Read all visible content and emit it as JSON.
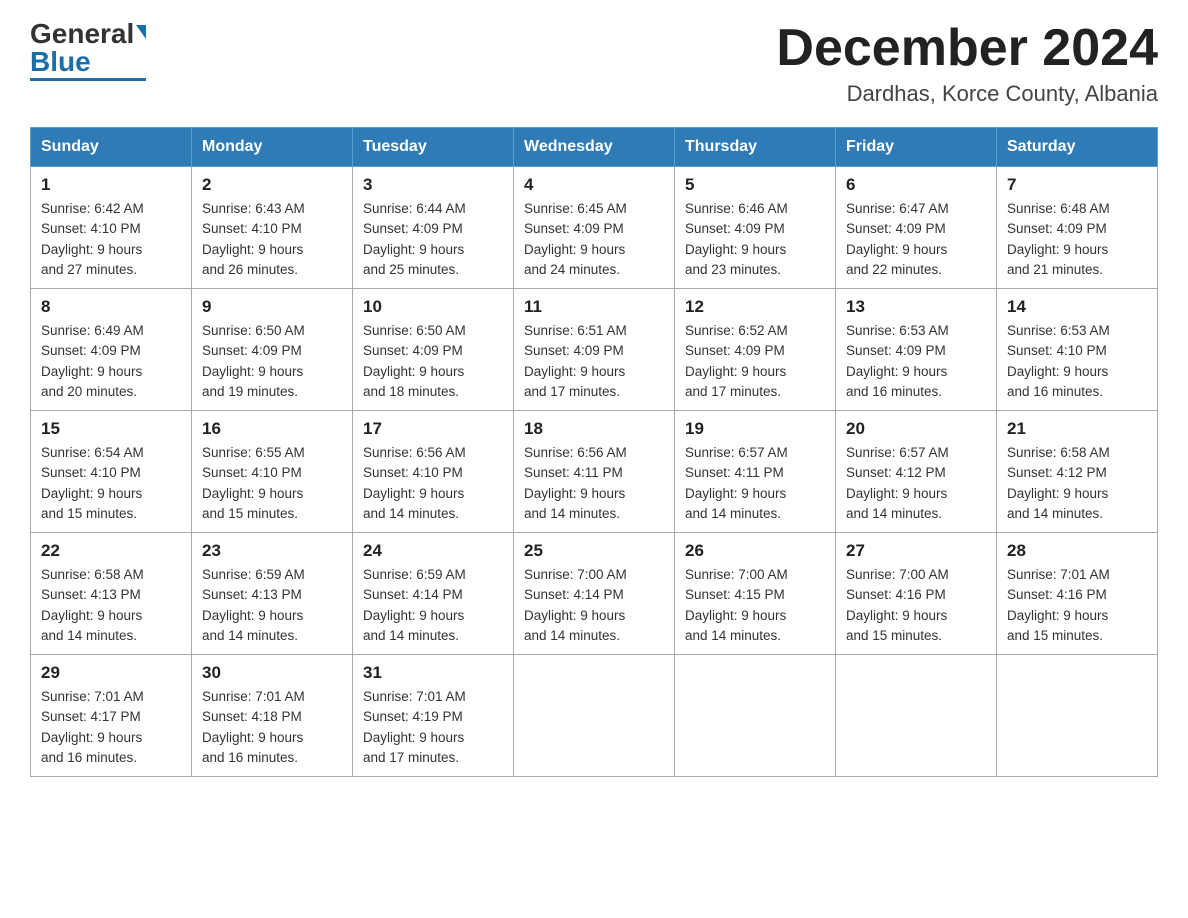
{
  "header": {
    "logo_general": "General",
    "logo_blue": "Blue",
    "month_title": "December 2024",
    "location": "Dardhas, Korce County, Albania"
  },
  "weekdays": [
    "Sunday",
    "Monday",
    "Tuesday",
    "Wednesday",
    "Thursday",
    "Friday",
    "Saturday"
  ],
  "weeks": [
    [
      {
        "day": "1",
        "sunrise": "6:42 AM",
        "sunset": "4:10 PM",
        "daylight": "9 hours and 27 minutes."
      },
      {
        "day": "2",
        "sunrise": "6:43 AM",
        "sunset": "4:10 PM",
        "daylight": "9 hours and 26 minutes."
      },
      {
        "day": "3",
        "sunrise": "6:44 AM",
        "sunset": "4:09 PM",
        "daylight": "9 hours and 25 minutes."
      },
      {
        "day": "4",
        "sunrise": "6:45 AM",
        "sunset": "4:09 PM",
        "daylight": "9 hours and 24 minutes."
      },
      {
        "day": "5",
        "sunrise": "6:46 AM",
        "sunset": "4:09 PM",
        "daylight": "9 hours and 23 minutes."
      },
      {
        "day": "6",
        "sunrise": "6:47 AM",
        "sunset": "4:09 PM",
        "daylight": "9 hours and 22 minutes."
      },
      {
        "day": "7",
        "sunrise": "6:48 AM",
        "sunset": "4:09 PM",
        "daylight": "9 hours and 21 minutes."
      }
    ],
    [
      {
        "day": "8",
        "sunrise": "6:49 AM",
        "sunset": "4:09 PM",
        "daylight": "9 hours and 20 minutes."
      },
      {
        "day": "9",
        "sunrise": "6:50 AM",
        "sunset": "4:09 PM",
        "daylight": "9 hours and 19 minutes."
      },
      {
        "day": "10",
        "sunrise": "6:50 AM",
        "sunset": "4:09 PM",
        "daylight": "9 hours and 18 minutes."
      },
      {
        "day": "11",
        "sunrise": "6:51 AM",
        "sunset": "4:09 PM",
        "daylight": "9 hours and 17 minutes."
      },
      {
        "day": "12",
        "sunrise": "6:52 AM",
        "sunset": "4:09 PM",
        "daylight": "9 hours and 17 minutes."
      },
      {
        "day": "13",
        "sunrise": "6:53 AM",
        "sunset": "4:09 PM",
        "daylight": "9 hours and 16 minutes."
      },
      {
        "day": "14",
        "sunrise": "6:53 AM",
        "sunset": "4:10 PM",
        "daylight": "9 hours and 16 minutes."
      }
    ],
    [
      {
        "day": "15",
        "sunrise": "6:54 AM",
        "sunset": "4:10 PM",
        "daylight": "9 hours and 15 minutes."
      },
      {
        "day": "16",
        "sunrise": "6:55 AM",
        "sunset": "4:10 PM",
        "daylight": "9 hours and 15 minutes."
      },
      {
        "day": "17",
        "sunrise": "6:56 AM",
        "sunset": "4:10 PM",
        "daylight": "9 hours and 14 minutes."
      },
      {
        "day": "18",
        "sunrise": "6:56 AM",
        "sunset": "4:11 PM",
        "daylight": "9 hours and 14 minutes."
      },
      {
        "day": "19",
        "sunrise": "6:57 AM",
        "sunset": "4:11 PM",
        "daylight": "9 hours and 14 minutes."
      },
      {
        "day": "20",
        "sunrise": "6:57 AM",
        "sunset": "4:12 PM",
        "daylight": "9 hours and 14 minutes."
      },
      {
        "day": "21",
        "sunrise": "6:58 AM",
        "sunset": "4:12 PM",
        "daylight": "9 hours and 14 minutes."
      }
    ],
    [
      {
        "day": "22",
        "sunrise": "6:58 AM",
        "sunset": "4:13 PM",
        "daylight": "9 hours and 14 minutes."
      },
      {
        "day": "23",
        "sunrise": "6:59 AM",
        "sunset": "4:13 PM",
        "daylight": "9 hours and 14 minutes."
      },
      {
        "day": "24",
        "sunrise": "6:59 AM",
        "sunset": "4:14 PM",
        "daylight": "9 hours and 14 minutes."
      },
      {
        "day": "25",
        "sunrise": "7:00 AM",
        "sunset": "4:14 PM",
        "daylight": "9 hours and 14 minutes."
      },
      {
        "day": "26",
        "sunrise": "7:00 AM",
        "sunset": "4:15 PM",
        "daylight": "9 hours and 14 minutes."
      },
      {
        "day": "27",
        "sunrise": "7:00 AM",
        "sunset": "4:16 PM",
        "daylight": "9 hours and 15 minutes."
      },
      {
        "day": "28",
        "sunrise": "7:01 AM",
        "sunset": "4:16 PM",
        "daylight": "9 hours and 15 minutes."
      }
    ],
    [
      {
        "day": "29",
        "sunrise": "7:01 AM",
        "sunset": "4:17 PM",
        "daylight": "9 hours and 16 minutes."
      },
      {
        "day": "30",
        "sunrise": "7:01 AM",
        "sunset": "4:18 PM",
        "daylight": "9 hours and 16 minutes."
      },
      {
        "day": "31",
        "sunrise": "7:01 AM",
        "sunset": "4:19 PM",
        "daylight": "9 hours and 17 minutes."
      },
      null,
      null,
      null,
      null
    ]
  ]
}
